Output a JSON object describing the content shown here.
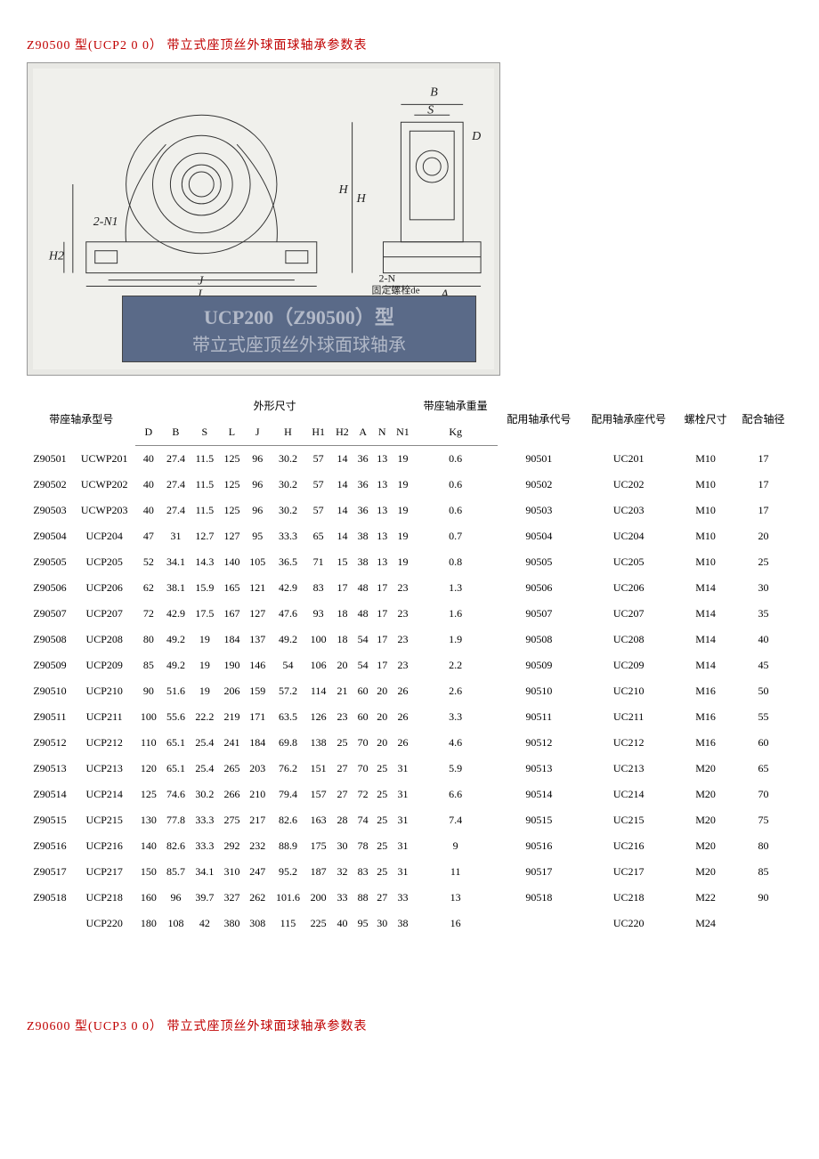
{
  "title_top": "Z90500 型(UCP2 0 0） 带立式座顶丝外球面球轴承参数表",
  "title_bottom": "Z90600 型(UCP3 0 0） 带立式座顶丝外球面球轴承参数表",
  "nameplate": {
    "line1": "UCP200（Z90500）型",
    "line2": "带立式座顶丝外球面球轴承"
  },
  "diagram_labels": {
    "B": "B",
    "S": "S",
    "D": "D",
    "H": "H",
    "H1_dim": "H",
    "two_N1": "2-N1",
    "H2_dim": "H2",
    "J": "J",
    "L": "L",
    "two_N": "2-N",
    "fixed": "固定螺栓de",
    "A": "A"
  },
  "headers": {
    "model": "带座轴承型号",
    "dims": "外形尺寸",
    "weight": "带座轴承重量",
    "bearing_code": "配用轴承代号",
    "housing_code": "配用轴承座代号",
    "bolt": "螺栓尺寸",
    "shaft": "配合轴径",
    "sub": {
      "D": "D",
      "B": "B",
      "S": "S",
      "L": "L",
      "J": "J",
      "H": "H",
      "H1": "H1",
      "H2": "H2",
      "A": "A",
      "N": "N",
      "N1": "N1",
      "Kg": "Kg"
    }
  },
  "rows": [
    {
      "c1": "Z90501",
      "c2": "UCWP201",
      "D": "40",
      "B": "27.4",
      "S": "11.5",
      "L": "125",
      "J": "96",
      "H": "30.2",
      "H1": "57",
      "H2": "14",
      "A": "36",
      "N": "13",
      "N1": "19",
      "Kg": "0.6",
      "bcode": "90501",
      "hcode": "UC201",
      "bolt": "M10",
      "shaft": "17"
    },
    {
      "c1": "Z90502",
      "c2": "UCWP202",
      "D": "40",
      "B": "27.4",
      "S": "11.5",
      "L": "125",
      "J": "96",
      "H": "30.2",
      "H1": "57",
      "H2": "14",
      "A": "36",
      "N": "13",
      "N1": "19",
      "Kg": "0.6",
      "bcode": "90502",
      "hcode": "UC202",
      "bolt": "M10",
      "shaft": "17"
    },
    {
      "c1": "Z90503",
      "c2": "UCWP203",
      "D": "40",
      "B": "27.4",
      "S": "11.5",
      "L": "125",
      "J": "96",
      "H": "30.2",
      "H1": "57",
      "H2": "14",
      "A": "36",
      "N": "13",
      "N1": "19",
      "Kg": "0.6",
      "bcode": "90503",
      "hcode": "UC203",
      "bolt": "M10",
      "shaft": "17"
    },
    {
      "c1": "Z90504",
      "c2": "UCP204",
      "D": "47",
      "B": "31",
      "S": "12.7",
      "L": "127",
      "J": "95",
      "H": "33.3",
      "H1": "65",
      "H2": "14",
      "A": "38",
      "N": "13",
      "N1": "19",
      "Kg": "0.7",
      "bcode": "90504",
      "hcode": "UC204",
      "bolt": "M10",
      "shaft": "20"
    },
    {
      "c1": "Z90505",
      "c2": "UCP205",
      "D": "52",
      "B": "34.1",
      "S": "14.3",
      "L": "140",
      "J": "105",
      "H": "36.5",
      "H1": "71",
      "H2": "15",
      "A": "38",
      "N": "13",
      "N1": "19",
      "Kg": "0.8",
      "bcode": "90505",
      "hcode": "UC205",
      "bolt": "M10",
      "shaft": "25"
    },
    {
      "c1": "Z90506",
      "c2": "UCP206",
      "D": "62",
      "B": "38.1",
      "S": "15.9",
      "L": "165",
      "J": "121",
      "H": "42.9",
      "H1": "83",
      "H2": "17",
      "A": "48",
      "N": "17",
      "N1": "23",
      "Kg": "1.3",
      "bcode": "90506",
      "hcode": "UC206",
      "bolt": "M14",
      "shaft": "30"
    },
    {
      "c1": "Z90507",
      "c2": "UCP207",
      "D": "72",
      "B": "42.9",
      "S": "17.5",
      "L": "167",
      "J": "127",
      "H": "47.6",
      "H1": "93",
      "H2": "18",
      "A": "48",
      "N": "17",
      "N1": "23",
      "Kg": "1.6",
      "bcode": "90507",
      "hcode": "UC207",
      "bolt": "M14",
      "shaft": "35"
    },
    {
      "c1": "Z90508",
      "c2": "UCP208",
      "D": "80",
      "B": "49.2",
      "S": "19",
      "L": "184",
      "J": "137",
      "H": "49.2",
      "H1": "100",
      "H2": "18",
      "A": "54",
      "N": "17",
      "N1": "23",
      "Kg": "1.9",
      "bcode": "90508",
      "hcode": "UC208",
      "bolt": "M14",
      "shaft": "40"
    },
    {
      "c1": "Z90509",
      "c2": "UCP209",
      "D": "85",
      "B": "49.2",
      "S": "19",
      "L": "190",
      "J": "146",
      "H": "54",
      "H1": "106",
      "H2": "20",
      "A": "54",
      "N": "17",
      "N1": "23",
      "Kg": "2.2",
      "bcode": "90509",
      "hcode": "UC209",
      "bolt": "M14",
      "shaft": "45"
    },
    {
      "c1": "Z90510",
      "c2": "UCP210",
      "D": "90",
      "B": "51.6",
      "S": "19",
      "L": "206",
      "J": "159",
      "H": "57.2",
      "H1": "114",
      "H2": "21",
      "A": "60",
      "N": "20",
      "N1": "26",
      "Kg": "2.6",
      "bcode": "90510",
      "hcode": "UC210",
      "bolt": "M16",
      "shaft": "50"
    },
    {
      "c1": "Z90511",
      "c2": "UCP211",
      "D": "100",
      "B": "55.6",
      "S": "22.2",
      "L": "219",
      "J": "171",
      "H": "63.5",
      "H1": "126",
      "H2": "23",
      "A": "60",
      "N": "20",
      "N1": "26",
      "Kg": "3.3",
      "bcode": "90511",
      "hcode": "UC211",
      "bolt": "M16",
      "shaft": "55"
    },
    {
      "c1": "Z90512",
      "c2": "UCP212",
      "D": "110",
      "B": "65.1",
      "S": "25.4",
      "L": "241",
      "J": "184",
      "H": "69.8",
      "H1": "138",
      "H2": "25",
      "A": "70",
      "N": "20",
      "N1": "26",
      "Kg": "4.6",
      "bcode": "90512",
      "hcode": "UC212",
      "bolt": "M16",
      "shaft": "60"
    },
    {
      "c1": "Z90513",
      "c2": "UCP213",
      "D": "120",
      "B": "65.1",
      "S": "25.4",
      "L": "265",
      "J": "203",
      "H": "76.2",
      "H1": "151",
      "H2": "27",
      "A": "70",
      "N": "25",
      "N1": "31",
      "Kg": "5.9",
      "bcode": "90513",
      "hcode": "UC213",
      "bolt": "M20",
      "shaft": "65"
    },
    {
      "c1": "Z90514",
      "c2": "UCP214",
      "D": "125",
      "B": "74.6",
      "S": "30.2",
      "L": "266",
      "J": "210",
      "H": "79.4",
      "H1": "157",
      "H2": "27",
      "A": "72",
      "N": "25",
      "N1": "31",
      "Kg": "6.6",
      "bcode": "90514",
      "hcode": "UC214",
      "bolt": "M20",
      "shaft": "70"
    },
    {
      "c1": "Z90515",
      "c2": "UCP215",
      "D": "130",
      "B": "77.8",
      "S": "33.3",
      "L": "275",
      "J": "217",
      "H": "82.6",
      "H1": "163",
      "H2": "28",
      "A": "74",
      "N": "25",
      "N1": "31",
      "Kg": "7.4",
      "bcode": "90515",
      "hcode": "UC215",
      "bolt": "M20",
      "shaft": "75"
    },
    {
      "c1": "Z90516",
      "c2": "UCP216",
      "D": "140",
      "B": "82.6",
      "S": "33.3",
      "L": "292",
      "J": "232",
      "H": "88.9",
      "H1": "175",
      "H2": "30",
      "A": "78",
      "N": "25",
      "N1": "31",
      "Kg": "9",
      "bcode": "90516",
      "hcode": "UC216",
      "bolt": "M20",
      "shaft": "80"
    },
    {
      "c1": "Z90517",
      "c2": "UCP217",
      "D": "150",
      "B": "85.7",
      "S": "34.1",
      "L": "310",
      "J": "247",
      "H": "95.2",
      "H1": "187",
      "H2": "32",
      "A": "83",
      "N": "25",
      "N1": "31",
      "Kg": "11",
      "bcode": "90517",
      "hcode": "UC217",
      "bolt": "M20",
      "shaft": "85"
    },
    {
      "c1": "Z90518",
      "c2": "UCP218",
      "D": "160",
      "B": "96",
      "S": "39.7",
      "L": "327",
      "J": "262",
      "H": "101.6",
      "H1": "200",
      "H2": "33",
      "A": "88",
      "N": "27",
      "N1": "33",
      "Kg": "13",
      "bcode": "90518",
      "hcode": "UC218",
      "bolt": "M22",
      "shaft": "90"
    },
    {
      "c1": "",
      "c2": "UCP220",
      "D": "180",
      "B": "108",
      "S": "42",
      "L": "380",
      "J": "308",
      "H": "115",
      "H1": "225",
      "H2": "40",
      "A": "95",
      "N": "30",
      "N1": "38",
      "Kg": "16",
      "bcode": "",
      "hcode": "UC220",
      "bolt": "M24",
      "shaft": ""
    }
  ]
}
